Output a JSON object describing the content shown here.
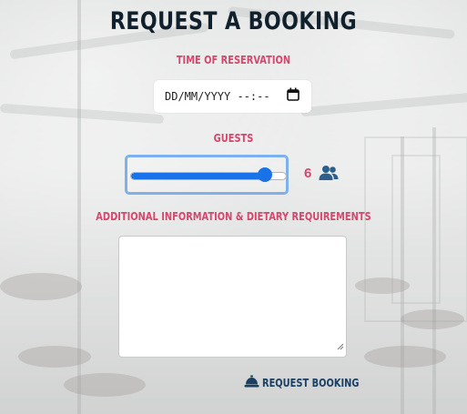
{
  "page": {
    "title": "Request a Booking"
  },
  "form": {
    "time_label": "TIME OF RESERVATION",
    "date_placeholder": "DD/MM/YYYY --:--",
    "guests_label": "GUESTS",
    "guests_value": "6",
    "guests_slider_fraction": 0.9,
    "info_label": "ADDITIONAL INFORMATION & DIETARY REQUIREMENTS",
    "info_value": "",
    "submit_label": "REQUEST BOOKING"
  },
  "icons": {
    "date": "calendar-icon",
    "guests": "users-icon",
    "submit": "concierge-bell-icon"
  },
  "colors": {
    "title": "#10202c",
    "label_accent": "#d5476d",
    "slider": "#1a72e8",
    "slider_focus": "#7fb0ec",
    "guests_icon": "#2c5f8c",
    "submit": "#1b3f63"
  }
}
